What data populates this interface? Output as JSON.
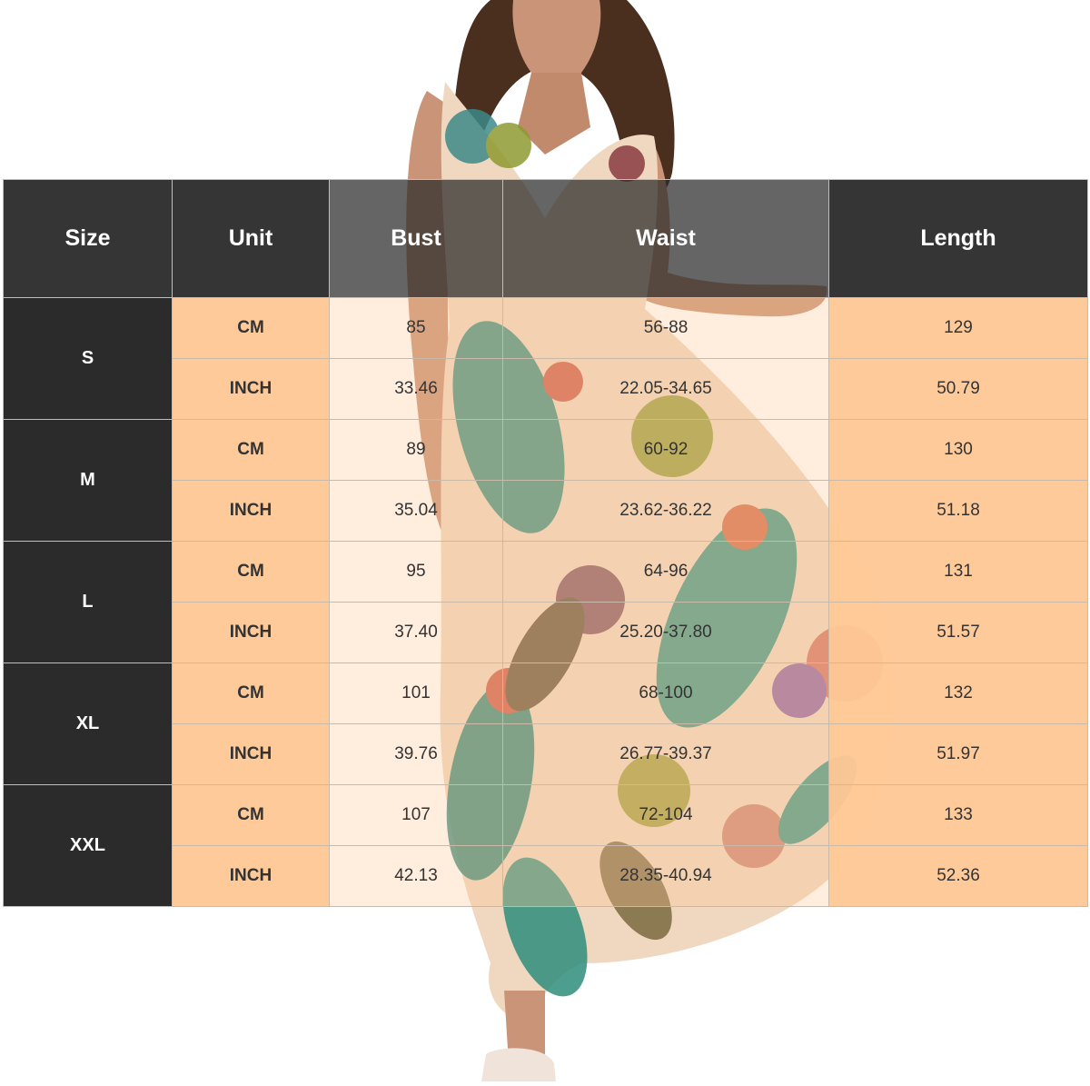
{
  "headers": {
    "size": "Size",
    "unit": "Unit",
    "bust": "Bust",
    "waist": "Waist",
    "length": "Length"
  },
  "rows": [
    {
      "size": "S",
      "cm": {
        "unit": "CM",
        "bust": "85",
        "waist": "56-88",
        "length": "129"
      },
      "inch": {
        "unit": "INCH",
        "bust": "33.46",
        "waist": "22.05-34.65",
        "length": "50.79"
      }
    },
    {
      "size": "M",
      "cm": {
        "unit": "CM",
        "bust": "89",
        "waist": "60-92",
        "length": "130"
      },
      "inch": {
        "unit": "INCH",
        "bust": "35.04",
        "waist": "23.62-36.22",
        "length": "51.18"
      }
    },
    {
      "size": "L",
      "cm": {
        "unit": "CM",
        "bust": "95",
        "waist": "64-96",
        "length": "131"
      },
      "inch": {
        "unit": "INCH",
        "bust": "37.40",
        "waist": "25.20-37.80",
        "length": "51.57"
      }
    },
    {
      "size": "XL",
      "cm": {
        "unit": "CM",
        "bust": "101",
        "waist": "68-100",
        "length": "132"
      },
      "inch": {
        "unit": "INCH",
        "bust": "39.76",
        "waist": "26.77-39.37",
        "length": "51.97"
      }
    },
    {
      "size": "XXL",
      "cm": {
        "unit": "CM",
        "bust": "107",
        "waist": "72-104",
        "length": "133"
      },
      "inch": {
        "unit": "INCH",
        "bust": "42.13",
        "waist": "28.35-40.94",
        "length": "52.36"
      }
    }
  ],
  "colors": {
    "header_bg": "#2a2a2a",
    "cell_bg": "#ffc896",
    "text": "#333333",
    "header_text": "#ffffff"
  }
}
